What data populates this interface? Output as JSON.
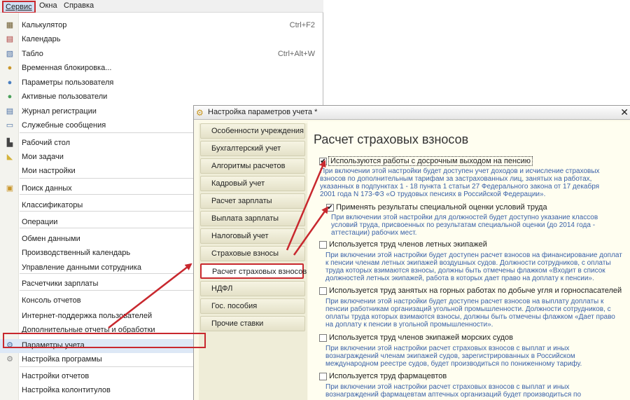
{
  "menubar": {
    "service": "Сервис",
    "windows": "Окна",
    "help": "Справка"
  },
  "menu_items": [
    {
      "label": "Калькулятор",
      "shortcut": "Ctrl+F2",
      "icon": "calculator-icon",
      "glyph": "▦",
      "color": "#6d5b2f"
    },
    {
      "label": "Календарь",
      "shortcut": "",
      "icon": "calendar-icon",
      "glyph": "▤",
      "color": "#a33"
    },
    {
      "label": "Табло",
      "shortcut": "Ctrl+Alt+W",
      "icon": "board-icon",
      "glyph": "▧",
      "color": "#4a6fa5"
    },
    {
      "label": "Временная блокировка...",
      "shortcut": "",
      "icon": "lock-user-icon",
      "glyph": "●",
      "color": "#c9962a"
    },
    {
      "label": "Параметры пользователя",
      "shortcut": "",
      "icon": "user-settings-icon",
      "glyph": "●",
      "color": "#4a7fc0"
    },
    {
      "label": "Активные пользователи",
      "shortcut": "",
      "icon": "active-users-icon",
      "glyph": "●",
      "color": "#4aa05a"
    },
    {
      "label": "Журнал регистрации",
      "shortcut": "",
      "icon": "log-icon",
      "glyph": "▤",
      "color": "#4a6fa5"
    },
    {
      "label": "Служебные сообщения",
      "shortcut": "",
      "icon": "messages-icon",
      "glyph": "▭",
      "color": "#4a6fa5"
    },
    {
      "label": "Рабочий стол",
      "shortcut": "",
      "icon": "desktop-icon",
      "glyph": "▙",
      "color": "#444"
    },
    {
      "label": "Мои задачи",
      "shortcut": "",
      "icon": "tasks-icon",
      "glyph": "◣",
      "color": "#d4b33a"
    },
    {
      "label": "Мои настройки",
      "shortcut": "",
      "icon": "",
      "glyph": "",
      "color": "#444"
    },
    {
      "label": "Поиск данных",
      "shortcut": "",
      "icon": "search-data-icon",
      "glyph": "▣",
      "color": "#c9962a"
    },
    {
      "label": "Классификаторы",
      "shortcut": "",
      "icon": "",
      "glyph": "",
      "color": "#444"
    },
    {
      "label": "Операции",
      "shortcut": "",
      "icon": "",
      "glyph": "",
      "color": "#444"
    },
    {
      "label": "Обмен данными",
      "shortcut": "",
      "icon": "",
      "glyph": "",
      "color": "#444"
    },
    {
      "label": "Производственный календарь",
      "shortcut": "",
      "icon": "",
      "glyph": "",
      "color": "#444"
    },
    {
      "label": "Управление данными сотрудника",
      "shortcut": "",
      "icon": "",
      "glyph": "",
      "color": "#444"
    },
    {
      "label": "Расчетчики зарплаты",
      "shortcut": "",
      "icon": "",
      "glyph": "",
      "color": "#444"
    },
    {
      "label": "Консоль отчетов",
      "shortcut": "",
      "icon": "",
      "glyph": "",
      "color": "#444"
    },
    {
      "label": "Интернет-поддержка пользователей",
      "shortcut": "",
      "icon": "",
      "glyph": "",
      "color": "#444"
    },
    {
      "label": "Дополнительные отчеты и обработки",
      "shortcut": "",
      "icon": "",
      "glyph": "",
      "color": "#444"
    },
    {
      "label": "Параметры учета",
      "shortcut": "",
      "icon": "accounting-params-icon",
      "glyph": "⚙",
      "color": "#4a6fa5"
    },
    {
      "label": "Настройка программы",
      "shortcut": "",
      "icon": "program-settings-icon",
      "glyph": "⚙",
      "color": "#888"
    },
    {
      "label": "Настройки отчетов",
      "shortcut": "",
      "icon": "",
      "glyph": "",
      "color": "#444"
    },
    {
      "label": "Настройка колонтитулов",
      "shortcut": "",
      "icon": "",
      "glyph": "",
      "color": "#444"
    }
  ],
  "dialog": {
    "title": "Настройка параметров учета *",
    "close": "✕",
    "nav": [
      "Особенности учреждения",
      "Бухгалтерский учет",
      "Алгоритмы расчетов",
      "Кадровый учет",
      "Расчет зарплаты",
      "Выплата зарплаты",
      "Налоговый учет",
      "Страховые взносы",
      "Расчет страховых взносов",
      "НДФЛ",
      "Гос. пособия",
      "Прочие ставки"
    ],
    "panel_title": "Расчет страховых взносов",
    "options": [
      {
        "label": "Используются работы с досрочным выходом на пенсию",
        "checked": true,
        "desc": [
          "При включении этой настройки будет доступен учет доходов и исчисление страховых",
          "взносов по дополнительным тарифам за застрахованных лиц, занятых на работах,",
          "указанных в подпунктах 1 - 18 пункта 1 статьи 27 Федерального закона от 17 декабря",
          "2001 года N 173-ФЗ «О трудовых пенсиях в Российской Федерации»."
        ]
      },
      {
        "label": "Применять результаты специальной оценки условий труда",
        "checked": true,
        "desc": [
          "При включении этой настройки для должностей будет доступно указание классов",
          "условий труда, присвоенных по результатам специальной оценки (до 2014 года -",
          "аттестации) рабочих мест."
        ]
      },
      {
        "label": "Используется труд членов летных экипажей",
        "checked": false,
        "desc": [
          "При включении этой настройки будет доступен расчет взносов на финансирование доплат",
          "к пенсии членам летных экипажей воздушных судов. Должности сотрудников, с оплаты",
          "труда которых взимаются взносы, должны быть отмечены флажком «Входит в список",
          "должностей летных экипажей, работа в которых дает право на доплату к пенсии»."
        ]
      },
      {
        "label": "Используется труд занятых на горных работах по добыче угля и горноспасателей",
        "checked": false,
        "desc": [
          "При включении этой настройки будет доступен расчет взносов на выплату доплаты к",
          "пенсии работникам организаций угольной промышленности. Должности сотрудников, с",
          "оплаты труда которых взимаются взносы, должны быть отмечены флажком «Дает право",
          "на доплату к пенсии в угольной промышленности»."
        ]
      },
      {
        "label": "Используется труд членов экипажей морских судов",
        "checked": false,
        "desc": [
          "При включении этой настройки расчет страховых взносов с выплат и иных",
          "вознаграждений членам экипажей судов, зарегистрированных в Российском",
          "международном реестре судов, будет производиться по пониженному тарифу."
        ]
      },
      {
        "label": "Используется труд фармацевтов",
        "checked": false,
        "desc": [
          "При включении этой настройки расчет страховых взносов с выплат и иных",
          "вознаграждений фармацевтам аптечных организаций будет производиться по"
        ]
      }
    ]
  },
  "colors": {
    "highlight": "#c8282e",
    "description": "#3b62a8",
    "dialog_bg": "#fbf9e8"
  }
}
